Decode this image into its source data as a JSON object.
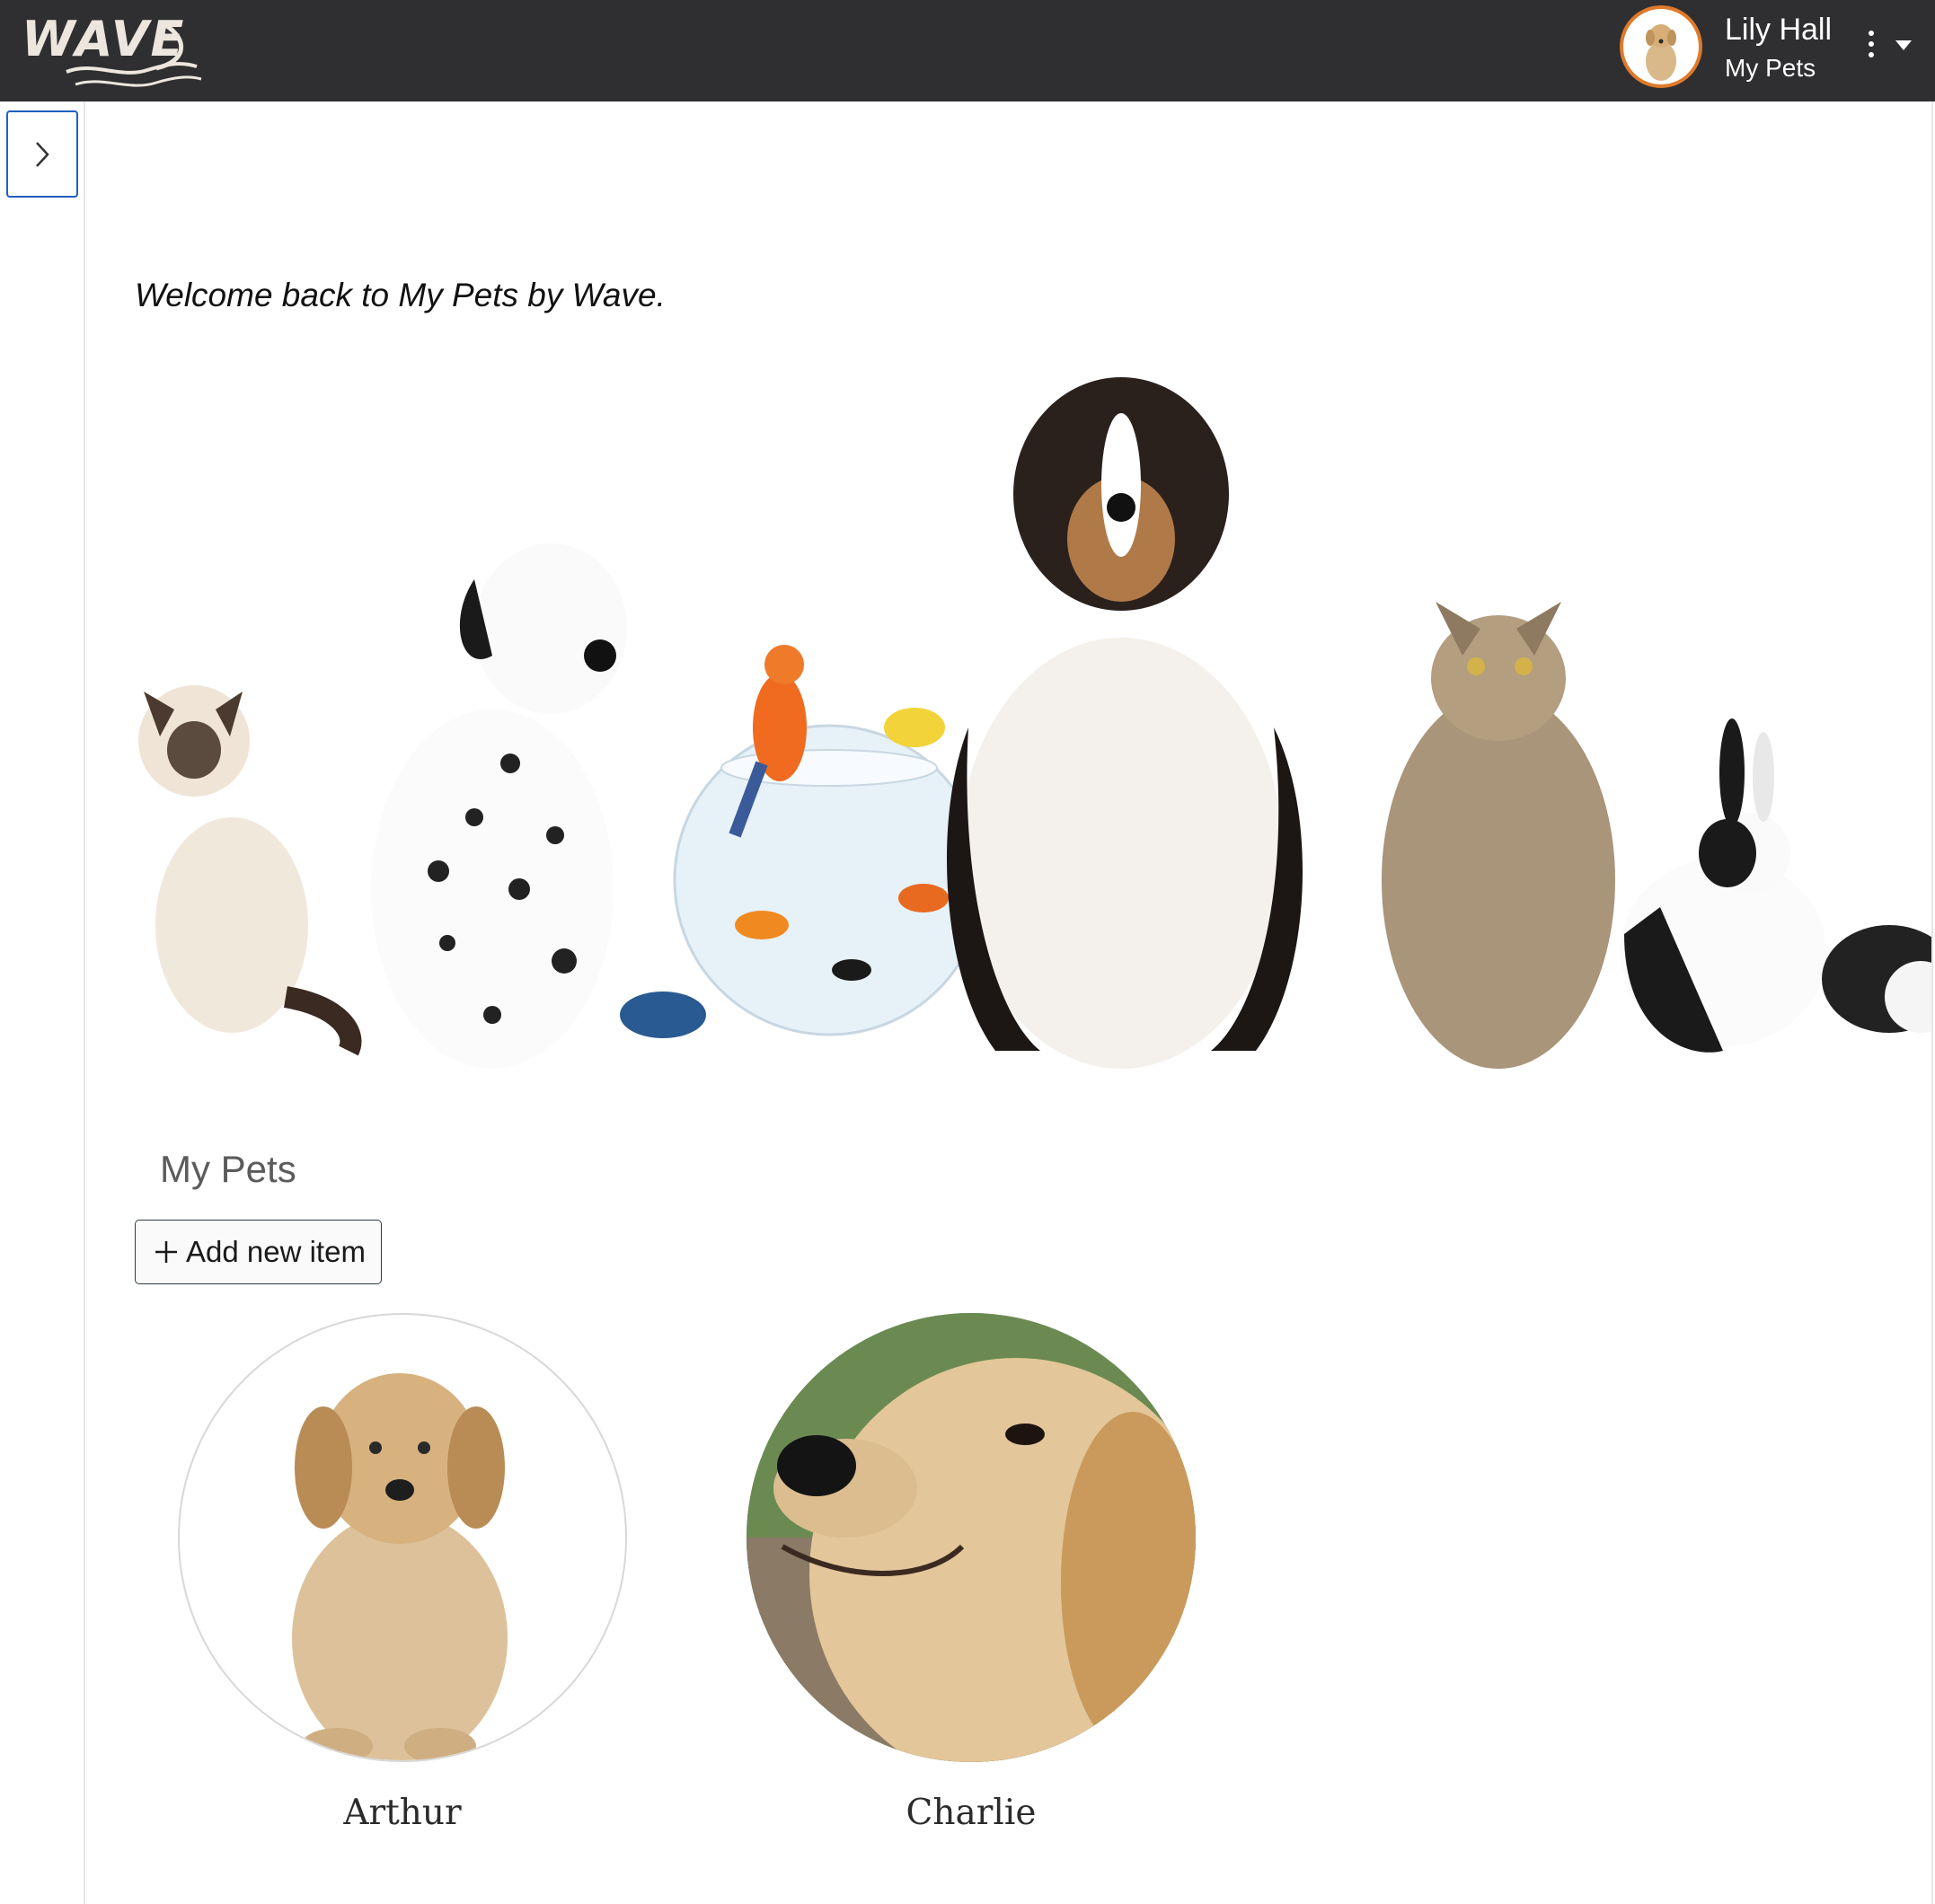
{
  "header": {
    "logo_text": "WAVE",
    "user_name": "Lily Hall",
    "user_subtitle": "My Pets"
  },
  "welcome_text": "Welcome back to My Pets by Wave.",
  "section": {
    "title": "My Pets",
    "add_button_label": "Add new item"
  },
  "pets": [
    {
      "name": "Arthur"
    },
    {
      "name": "Charlie"
    }
  ],
  "colors": {
    "header_bg": "#2f2f31",
    "avatar_ring": "#e07a2a",
    "focus_border": "#1f5fbf"
  }
}
